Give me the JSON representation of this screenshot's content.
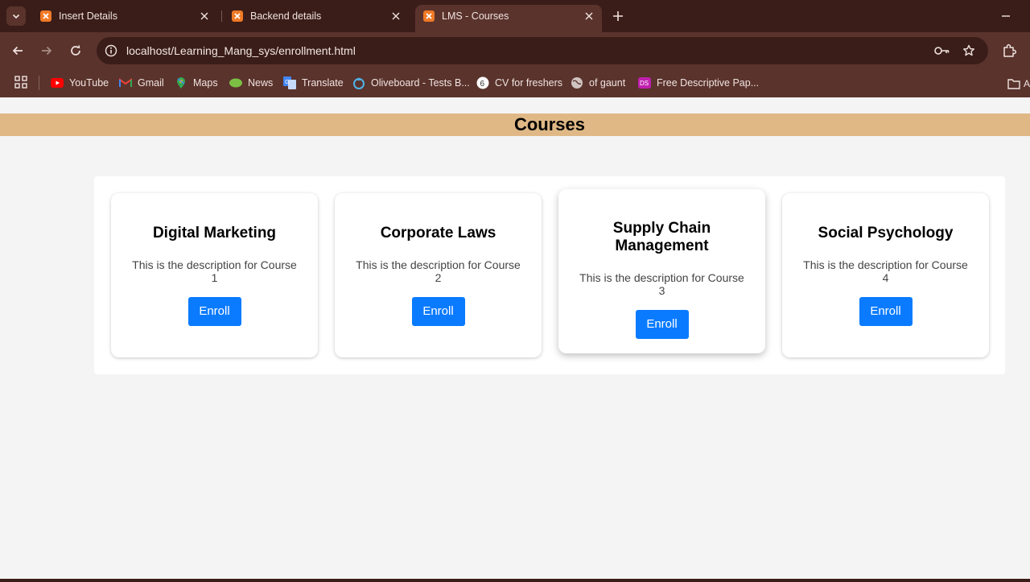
{
  "browser": {
    "tabs": [
      {
        "title": "Insert Details",
        "active": false
      },
      {
        "title": "Backend details",
        "active": false
      },
      {
        "title": "LMS - Courses",
        "active": true
      }
    ],
    "url": "localhost/Learning_Mang_sys/enrollment.html",
    "bookmarks": [
      {
        "label": "YouTube",
        "icon": "youtube-icon"
      },
      {
        "label": "Gmail",
        "icon": "gmail-icon"
      },
      {
        "label": "Maps",
        "icon": "maps-icon"
      },
      {
        "label": "News",
        "icon": "news-icon"
      },
      {
        "label": "Translate",
        "icon": "translate-icon"
      },
      {
        "label": "Oliveboard - Tests B...",
        "icon": "oliveboard-icon"
      },
      {
        "label": "CV for freshers",
        "icon": "cv-icon"
      },
      {
        "label": "of gaunt",
        "icon": "globe-icon"
      },
      {
        "label": "Free Descriptive Pap...",
        "icon": "descriptive-icon"
      }
    ],
    "bookmark_folder_label": "A"
  },
  "page": {
    "heading": "Courses",
    "banner_color": "#dfb886",
    "button_color": "#0a7bff",
    "courses": [
      {
        "title": "Digital Marketing",
        "description": "This is the description for Course 1",
        "button": "Enroll"
      },
      {
        "title": "Corporate Laws",
        "description": "This is the description for Course 2",
        "button": "Enroll"
      },
      {
        "title": "Supply Chain Management",
        "description": "This is the description for Course 3",
        "button": "Enroll"
      },
      {
        "title": "Social Psychology",
        "description": "This is the description for Course 4",
        "button": "Enroll"
      }
    ]
  }
}
